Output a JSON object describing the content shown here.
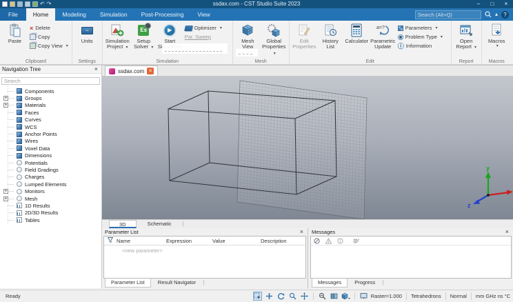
{
  "glyphs": {
    "close": "×",
    "minimize": "–",
    "maximize": "□",
    "dropdown": "▾",
    "undo": "↶",
    "redo": "↷",
    "caret_up": "▴",
    "help": "?",
    "play": "▶",
    "wave": "~",
    "es": "Es",
    "plus": "+",
    "delete_x": "×",
    "info": "ⓘ",
    "search": "⌕",
    "pipe": "|"
  },
  "titlebar": {
    "title": "ssdax.com - CST Studio Suite 2023"
  },
  "search": {
    "placeholder": "Search (Alt+Q)"
  },
  "tabs": {
    "file": "File",
    "home": "Home",
    "modeling": "Modeling",
    "simulation": "Simulation",
    "post": "Post-Processing",
    "view": "View"
  },
  "ribbon": {
    "clipboard": {
      "label": "Clipboard",
      "paste": "Paste",
      "delete": "Delete",
      "copy": "Copy",
      "copy_view": "Copy View"
    },
    "settings": {
      "label": "Settings",
      "units": "Units"
    },
    "simulation": {
      "label": "Simulation",
      "sim_project_1": "Simulation",
      "sim_project_2": "Project",
      "setup_solver_1": "Setup",
      "setup_solver_2": "Solver",
      "start_sim_1": "Start",
      "start_sim_2": "Simulation",
      "optimizer": "Optimizer",
      "par_sweep": "Par. Sweep"
    },
    "mesh": {
      "label": "Mesh",
      "mesh_view_1": "Mesh",
      "mesh_view_2": "View",
      "global_props_1": "Global",
      "global_props_2": "Properties"
    },
    "edit": {
      "label": "Edit",
      "edit_props_1": "Edit",
      "edit_props_2": "Properties",
      "history_1": "History",
      "history_2": "List",
      "calculator": "Calculator",
      "parametric_1": "Parametric",
      "parametric_2": "Update",
      "parameters": "Parameters",
      "problem_type": "Problem Type",
      "information": "Information"
    },
    "report": {
      "label": "Report",
      "open_report_1": "Open",
      "open_report_2": "Report"
    },
    "macros": {
      "label": "Macros",
      "macros": "Macros"
    }
  },
  "nav": {
    "title": "Navigation Tree",
    "search_placeholder": "Search",
    "items": [
      {
        "label": "Components",
        "icon": "cube",
        "expand": false
      },
      {
        "label": "Groups",
        "icon": "cube",
        "expand": true
      },
      {
        "label": "Materials",
        "icon": "cube",
        "expand": true
      },
      {
        "label": "Faces",
        "icon": "cube",
        "expand": false
      },
      {
        "label": "Curves",
        "icon": "cube",
        "expand": false
      },
      {
        "label": "WCS",
        "icon": "cube",
        "expand": false
      },
      {
        "label": "Anchor Points",
        "icon": "cube",
        "expand": false
      },
      {
        "label": "Wires",
        "icon": "cube",
        "expand": false
      },
      {
        "label": "Voxel Data",
        "icon": "cube",
        "expand": false
      },
      {
        "label": "Dimensions",
        "icon": "cube",
        "expand": false
      },
      {
        "label": "Potentials",
        "icon": "circle",
        "expand": false
      },
      {
        "label": "Field Gradings",
        "icon": "circle",
        "expand": false
      },
      {
        "label": "Charges",
        "icon": "circle",
        "expand": false
      },
      {
        "label": "Lumped Elements",
        "icon": "circle",
        "expand": false
      },
      {
        "label": "Monitors",
        "icon": "circle",
        "expand": true
      },
      {
        "label": "Mesh",
        "icon": "circle",
        "expand": true
      },
      {
        "label": "1D Results",
        "icon": "chart",
        "expand": false
      },
      {
        "label": "2D/3D Results",
        "icon": "chart",
        "expand": false
      },
      {
        "label": "Tables",
        "icon": "chart",
        "expand": false
      }
    ]
  },
  "doc_tab": {
    "title": "ssdax.com"
  },
  "view_tabs": {
    "t3d": "3D",
    "schematic": "Schematic"
  },
  "axes": {
    "x": "x",
    "y": "y",
    "z": "z"
  },
  "params": {
    "title": "Parameter List",
    "col_name": "Name",
    "col_expression": "Expression",
    "col_value": "Value",
    "col_description": "Description",
    "new_row": "<new parameter>",
    "tab_param": "Parameter List",
    "tab_result": "Result Navigator"
  },
  "messages": {
    "title": "Messages",
    "tab_messages": "Messages",
    "tab_progress": "Progress"
  },
  "status": {
    "ready": "Ready",
    "raster": "Raster=1.000",
    "mesh_type": "Tetrahedrons",
    "normal": "Normal",
    "units": "mm GHz ns °C"
  }
}
